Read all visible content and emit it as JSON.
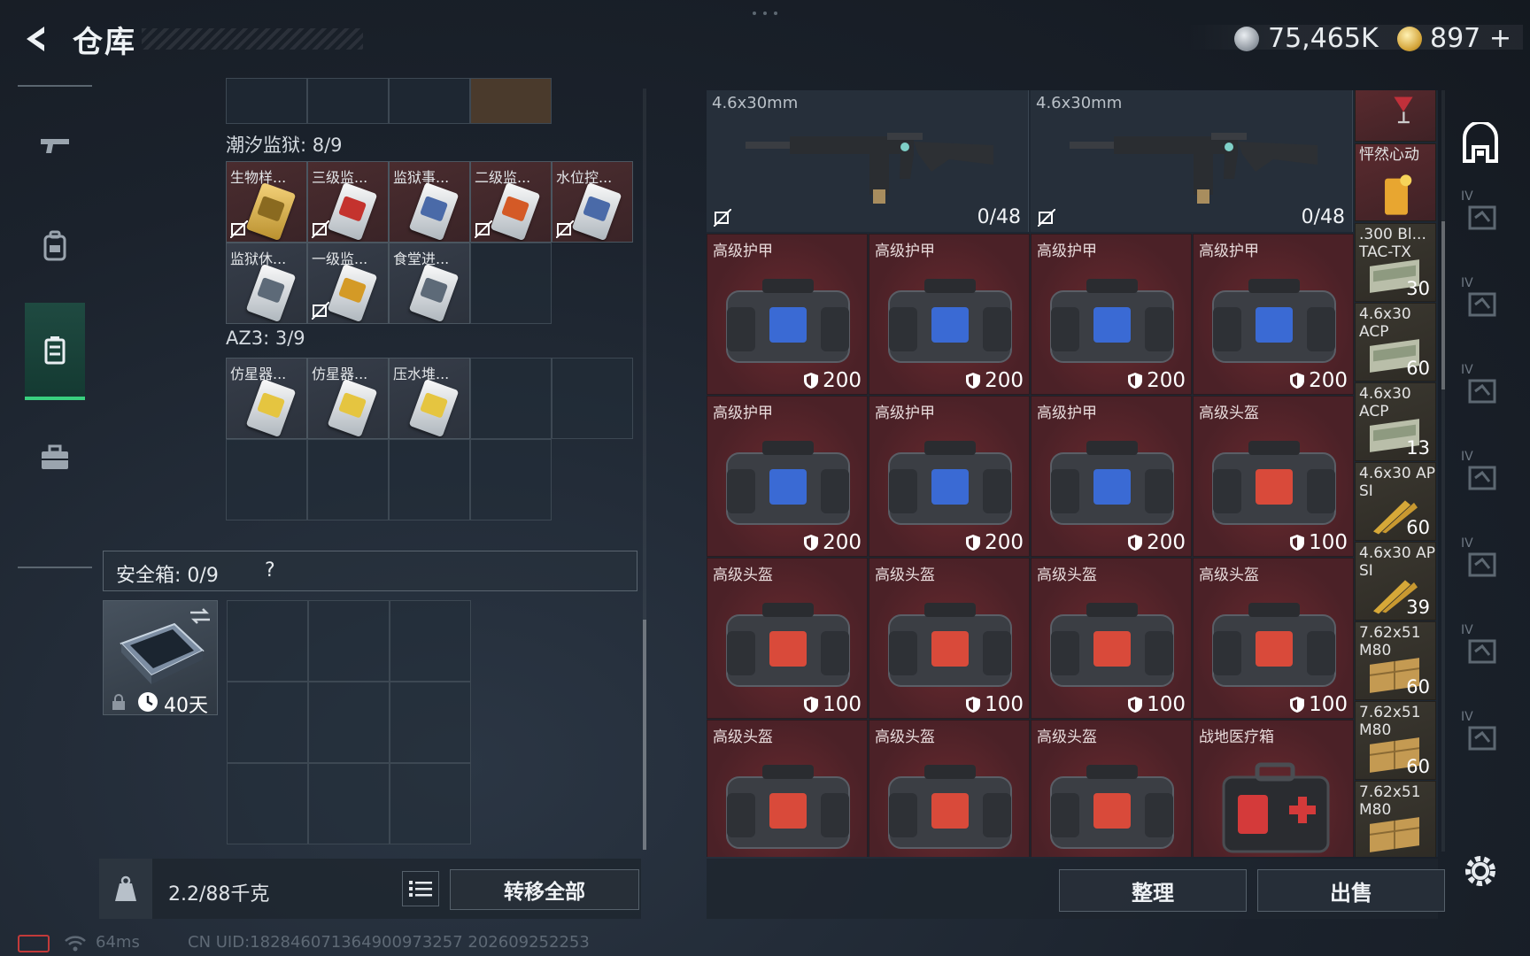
{
  "header": {
    "title": "仓库",
    "silver_amount": "75,465K",
    "gold_amount": "897",
    "gold_plus": "+"
  },
  "sidebar": {
    "items": [
      {
        "icon": "gun-icon",
        "label": "weapons"
      },
      {
        "icon": "backpack-icon",
        "label": "backpack"
      },
      {
        "icon": "container-icon",
        "label": "container",
        "active": true
      },
      {
        "icon": "briefcase-icon",
        "label": "briefcase"
      }
    ]
  },
  "containers": {
    "prison": {
      "title": "潮汐监狱: 8/9",
      "items": [
        "生物样...",
        "三级监...",
        "监狱事...",
        "二级监...",
        "水位控...",
        "监狱休...",
        "一级监...",
        "食堂进..."
      ]
    },
    "az3": {
      "title": "AZ3: 3/9",
      "items": [
        "仿星器...",
        "仿星器...",
        "压水堆..."
      ]
    }
  },
  "safe_box": {
    "label": "安全箱: 0/9",
    "help": "?",
    "time_left": "40天"
  },
  "bottom_left": {
    "weight": "2.2/88千克",
    "transfer_all": "转移全部"
  },
  "stash": {
    "weapons": [
      {
        "caliber": "4.6x30mm",
        "ammo": "0/48"
      },
      {
        "caliber": "4.6x30mm",
        "ammo": "0/48"
      }
    ],
    "gear": [
      {
        "name": "高级护甲",
        "durability": "200",
        "kind": "armor"
      },
      {
        "name": "高级护甲",
        "durability": "200",
        "kind": "armor"
      },
      {
        "name": "高级护甲",
        "durability": "200",
        "kind": "armor"
      },
      {
        "name": "高级护甲",
        "durability": "200",
        "kind": "armor"
      },
      {
        "name": "高级护甲",
        "durability": "200",
        "kind": "armor"
      },
      {
        "name": "高级护甲",
        "durability": "200",
        "kind": "armor"
      },
      {
        "name": "高级护甲",
        "durability": "200",
        "kind": "armor"
      },
      {
        "name": "高级头盔",
        "durability": "100",
        "kind": "helmet"
      },
      {
        "name": "高级头盔",
        "durability": "100",
        "kind": "helmet"
      },
      {
        "name": "高级头盔",
        "durability": "100",
        "kind": "helmet"
      },
      {
        "name": "高级头盔",
        "durability": "100",
        "kind": "helmet"
      },
      {
        "name": "高级头盔",
        "durability": "100",
        "kind": "helmet"
      },
      {
        "name": "高级头盔",
        "durability": "",
        "kind": "helmet"
      },
      {
        "name": "高级头盔",
        "durability": "",
        "kind": "helmet"
      },
      {
        "name": "高级头盔",
        "durability": "",
        "kind": "helmet"
      },
      {
        "name": "战地医疗箱",
        "durability": "",
        "kind": "medkit"
      }
    ],
    "side_items": [
      {
        "name": "",
        "count": ""
      },
      {
        "name": "怦然心动",
        "count": ""
      },
      {
        "name": ".300 Bl... TAC-TX",
        "count": "30"
      },
      {
        "name": "4.6x30 ACP",
        "count": "60"
      },
      {
        "name": "4.6x30 ACP",
        "count": "13"
      },
      {
        "name": "4.6x30 AP SI",
        "count": "60"
      },
      {
        "name": "4.6x30 AP SI",
        "count": "39"
      },
      {
        "name": "7.62x51 M80",
        "count": "60"
      },
      {
        "name": "7.62x51 M80",
        "count": "60"
      },
      {
        "name": "7.62x51 M80",
        "count": ""
      }
    ],
    "organize": "整理",
    "sell": "出售"
  },
  "right_sidebar": {
    "tiers": [
      "IV",
      "IV",
      "IV",
      "IV",
      "IV",
      "IV",
      "IV"
    ]
  },
  "status_bar": {
    "ping": "64ms",
    "uid": "CN UID:18284607136490097325​7 202609252253"
  },
  "colors": {
    "accent_green": "#39d17f",
    "gear_red": "#5a252b",
    "panel_dark": "#1e2732"
  }
}
